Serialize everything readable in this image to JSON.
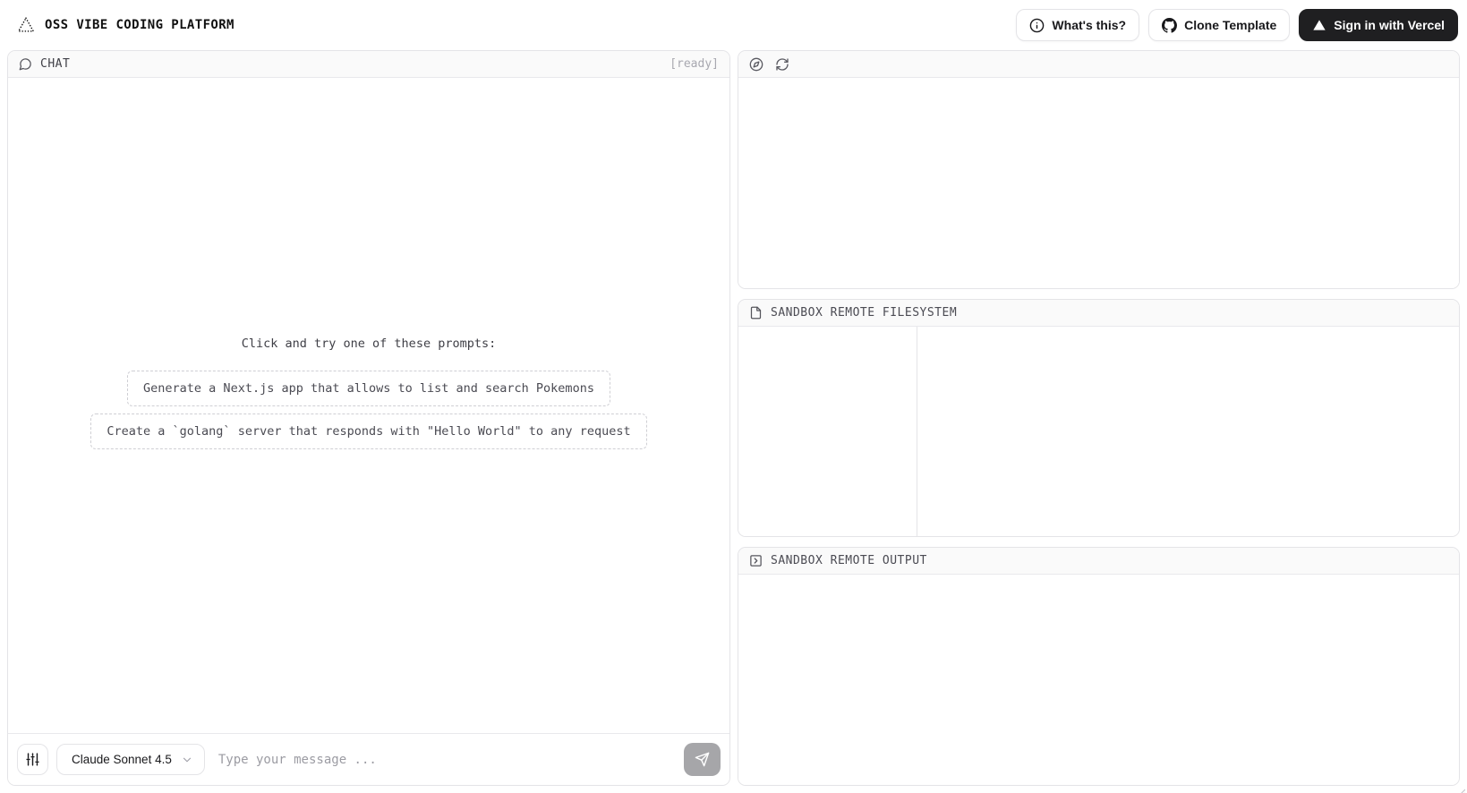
{
  "app": {
    "title": "OSS VIBE CODING PLATFORM"
  },
  "topbar": {
    "whats_this_label": "What's this?",
    "clone_template_label": "Clone Template",
    "sign_in_label": "Sign in with Vercel"
  },
  "chat": {
    "header_title": "CHAT",
    "status": "[ready]",
    "empty_heading": "Click and try one of these prompts:",
    "prompts": [
      "Generate a Next.js app that allows to list and search Pokemons",
      "Create a `golang` server that responds with \"Hello World\" to any request"
    ],
    "model_selector": "Claude Sonnet 4.5",
    "input_placeholder": "Type your message ..."
  },
  "panels": {
    "filesystem_title": "SANDBOX REMOTE FILESYSTEM",
    "output_title": "SANDBOX REMOTE OUTPUT"
  },
  "colors": {
    "panel_border": "#e4e4e7",
    "panel_header_bg": "#fafafa",
    "muted_text": "#a8a8b0",
    "dark_button_bg": "#1f1f21",
    "send_button_bg": "#a6a6a9"
  }
}
